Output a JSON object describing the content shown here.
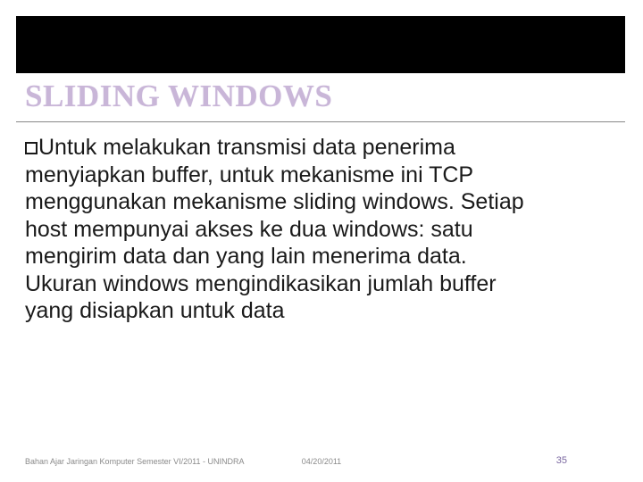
{
  "title": "SLIDING WINDOWS",
  "bullet_lead": "Untuk",
  "body_rest": " melakukan transmisi data penerima menyiapkan buffer, untuk mekanisme ini TCP menggunakan mekanisme sliding windows. Setiap host mempunyai akses ke dua windows: satu mengirim data dan yang lain menerima data. Ukuran windows mengindikasikan jumlah buffer yang disiapkan untuk data",
  "footer": {
    "left": "Bahan Ajar Jaringan Komputer Semester VI/2011 - UNINDRA",
    "center": "04/20/2011",
    "right": "35"
  }
}
